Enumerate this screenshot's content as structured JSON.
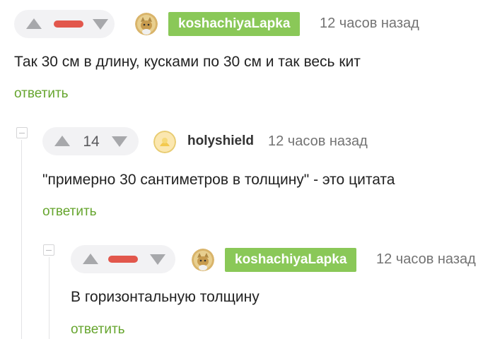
{
  "comments": [
    {
      "author": "koshachiyaLapka",
      "time": "12 часов назад",
      "text": "Так 30 см в длину, кусками по 30 см и так весь кит",
      "reply_label": "ответить"
    },
    {
      "author": "holyshield",
      "rating": "14",
      "time": "12 часов назад",
      "text": "\"примерно 30 сантиметров в толщину\" - это цитата",
      "reply_label": "ответить"
    },
    {
      "author": "koshachiyaLapka",
      "time": "12 часов назад",
      "text": "В горизонтальную толщину",
      "reply_label": "ответить"
    }
  ],
  "colors": {
    "author_badge": "#8ac858",
    "reply_link": "#66a52e",
    "negative_rating": "#e2574c",
    "rating_bg": "#f2f2f4"
  },
  "icons": [
    "arrow-up-icon",
    "arrow-down-icon",
    "negative-rating-icon",
    "collapse-icon",
    "avatar"
  ]
}
